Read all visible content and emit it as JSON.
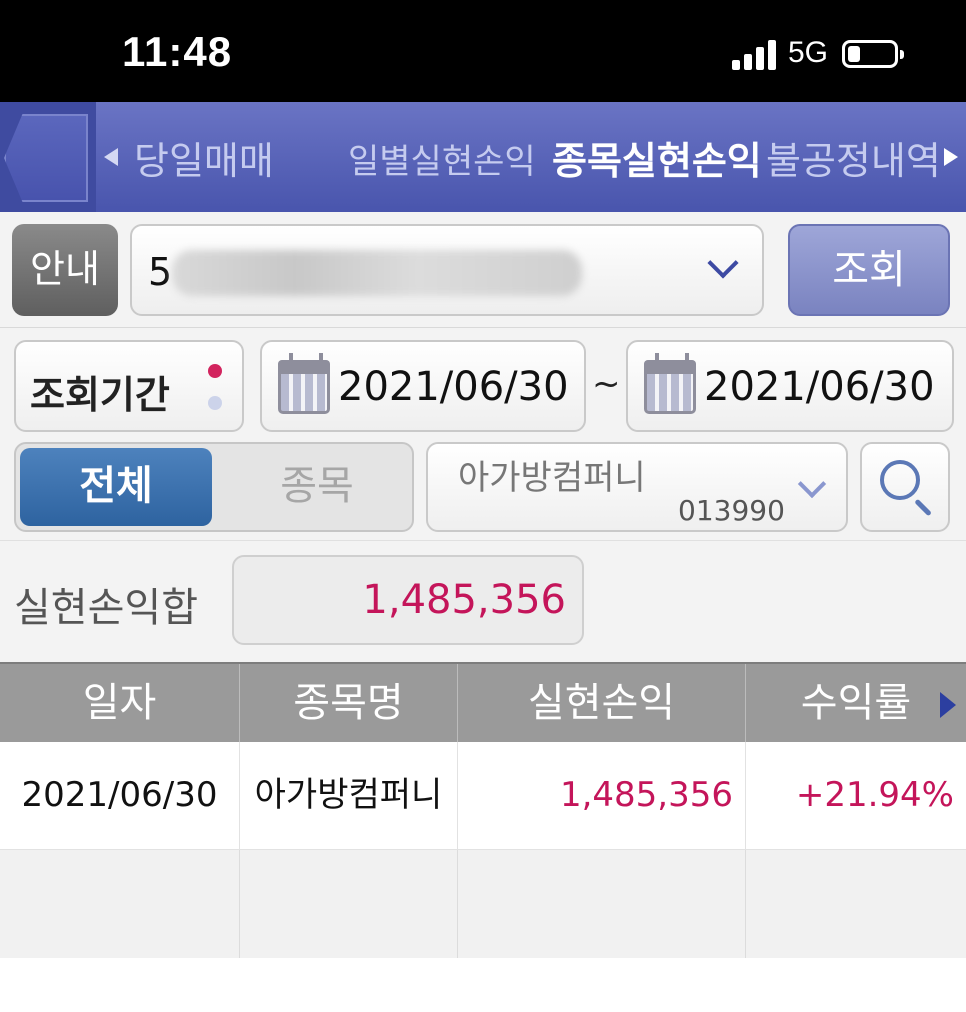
{
  "status_bar": {
    "time": "11:48",
    "network": "5G"
  },
  "nav": {
    "tabs": [
      "당일매매",
      "일별실현손익",
      "종목실현손익",
      "불공정내역"
    ],
    "active_index": 2
  },
  "account": {
    "info_label": "안내",
    "number_visible": "5",
    "query_label": "조회"
  },
  "period": {
    "label": "조회기간",
    "start_date": "2021/06/30",
    "separator": "~",
    "end_date": "2021/06/30"
  },
  "filter": {
    "segments": [
      "전체",
      "종목"
    ],
    "active_segment": "전체",
    "stock_name": "아가방컴퍼니",
    "stock_code": "013990"
  },
  "summary": {
    "label": "실현손익합",
    "value": "1,485,356"
  },
  "table": {
    "columns": [
      "일자",
      "종목명",
      "실현손익",
      "수익률"
    ],
    "rows": [
      {
        "date": "2021/06/30",
        "name": "아가방컴퍼니",
        "pnl": "1,485,356",
        "rate": "+21.94%"
      }
    ]
  },
  "colors": {
    "nav_bg": "#4955ad",
    "accent_red": "#c4155a",
    "segment_active": "#2e63a0"
  }
}
